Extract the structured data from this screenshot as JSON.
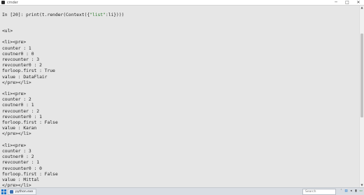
{
  "window": {
    "title": "cmder",
    "controls": {
      "minimize": "─",
      "maximize": "□",
      "close": "✕"
    }
  },
  "console": {
    "prompt": "In [20]: ",
    "command_before_string": "print(t.render(Context({",
    "command_string": "\"list\"",
    "command_after_string": ":li})))",
    "opening_tag": "<ul>",
    "blocks": [
      {
        "lines": [
          "<li><pre>",
          "counter : 1",
          "coutner0 : 0",
          "revcounter : 3",
          "revcounter0 : 2",
          "forloop.first : True",
          "value : DataFlair",
          "</pre></li>"
        ]
      },
      {
        "lines": [
          "<li><pre>",
          "counter : 2",
          "coutner0 : 1",
          "revcounter : 2",
          "revcounter0 : 1",
          "forloop.first : False",
          "value : Karan",
          "</pre></li>"
        ]
      },
      {
        "lines": [
          "<li><pre>",
          "counter : 3",
          "coutner0 : 2",
          "revcounter : 1",
          "revcounter0 : 0",
          "forloop.first : False",
          "value : Mittal",
          "</pre></li>"
        ]
      }
    ]
  },
  "scrollbar": {
    "up_arrow": "▲",
    "down_arrow": "▼"
  },
  "taskbar": {
    "task_label": "python.exe",
    "search_placeholder": "Search",
    "tray_icons": [
      "arrow-up-icon",
      "network-icon",
      "volume-icon",
      "battery-icon",
      "notification-icon"
    ],
    "tray_glyphs": [
      "˄",
      "▤",
      "◂",
      "▮",
      "▭"
    ]
  },
  "colors": {
    "console_background": "#e6e6e6",
    "string_literal": "#2c7a2c",
    "start_button": "#1a73c9"
  }
}
